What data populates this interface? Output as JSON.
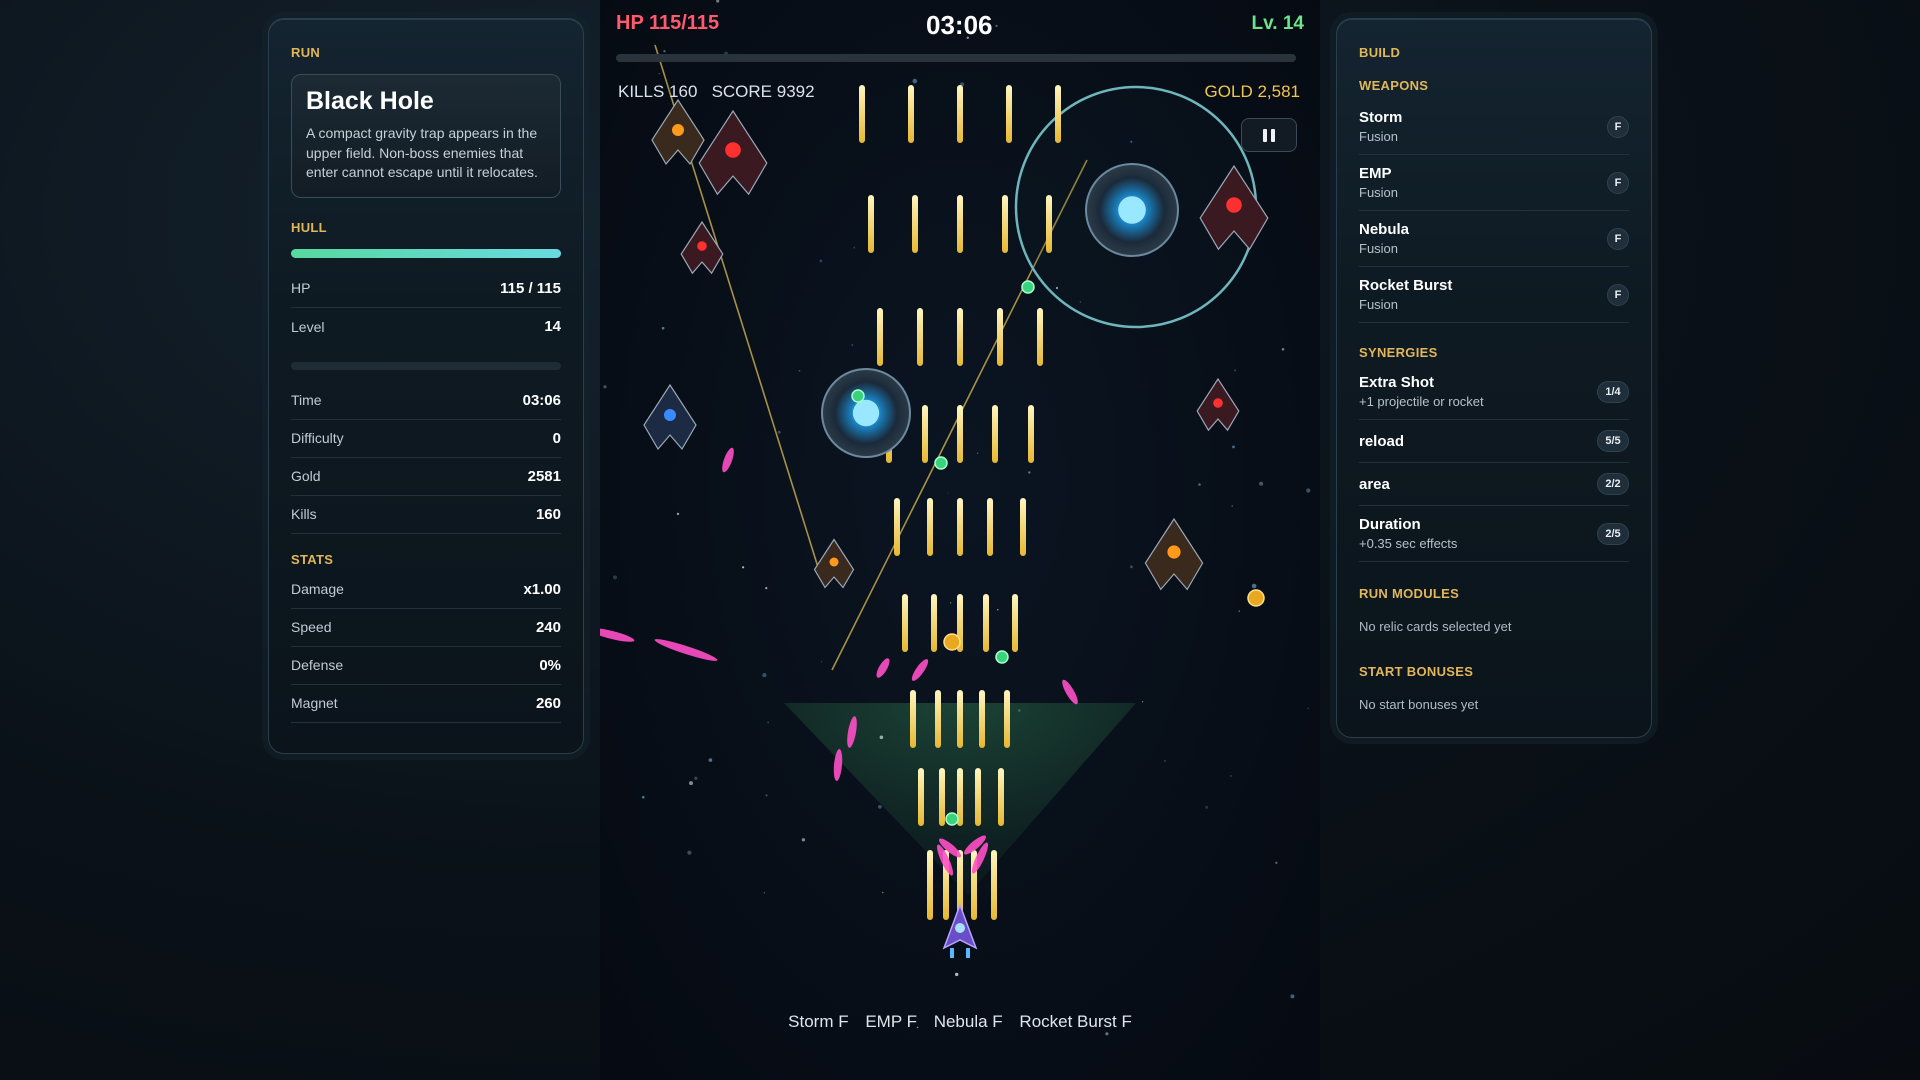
{
  "left": {
    "run_title": "RUN",
    "event_title": "Black Hole",
    "event_desc": "A compact gravity trap appears in the upper field. Non-boss enemies that enter cannot escape until it relocates.",
    "hull_title": "HULL",
    "hull_fraction": 1.0,
    "rows_top": [
      {
        "label": "HP",
        "value": "115 / 115"
      },
      {
        "label": "Level",
        "value": "14"
      }
    ],
    "rows_mid": [
      {
        "label": "Time",
        "value": "03:06"
      },
      {
        "label": "Difficulty",
        "value": "0"
      },
      {
        "label": "Gold",
        "value": "2581"
      },
      {
        "label": "Kills",
        "value": "160"
      }
    ],
    "stats_title": "STATS",
    "stats": [
      {
        "label": "Damage",
        "value": "x1.00"
      },
      {
        "label": "Speed",
        "value": "240"
      },
      {
        "label": "Defense",
        "value": "0%"
      },
      {
        "label": "Magnet",
        "value": "260"
      }
    ]
  },
  "right": {
    "build_title": "BUILD",
    "weapons_title": "WEAPONS",
    "weapons": [
      {
        "name": "Storm",
        "sub": "Fusion",
        "badge": "F"
      },
      {
        "name": "EMP",
        "sub": "Fusion",
        "badge": "F"
      },
      {
        "name": "Nebula",
        "sub": "Fusion",
        "badge": "F"
      },
      {
        "name": "Rocket Burst",
        "sub": "Fusion",
        "badge": "F"
      }
    ],
    "synergies_title": "SYNERGIES",
    "synergies": [
      {
        "name": "Extra Shot",
        "sub": "+1 projectile or rocket",
        "badge": "1/4"
      },
      {
        "name": "reload",
        "sub": "",
        "badge": "5/5"
      },
      {
        "name": "area",
        "sub": "",
        "badge": "2/2"
      },
      {
        "name": "Duration",
        "sub": "+0.35 sec effects",
        "badge": "2/5"
      }
    ],
    "modules_title": "RUN MODULES",
    "modules_note": "No relic cards selected yet",
    "bonuses_title": "START BONUSES",
    "bonuses_note": "No start bonuses yet"
  },
  "hud": {
    "hp": "HP 115/115",
    "timer": "03:06",
    "level": "Lv. 14",
    "stats": "KILLS 160   SCORE 9392",
    "gold": "GOLD 2,581",
    "pause_label": "pause"
  },
  "weapon_strip": [
    "Storm F",
    "EMP F",
    "Nebula F",
    "Rocket Burst F"
  ],
  "colors": {
    "accent_gold": "#e2b65a",
    "hp_red": "#ff5a6e",
    "level_green": "#6de38a",
    "bullet_yellow": "#f4d35e",
    "plasma_pink": "#ff4fc8"
  }
}
